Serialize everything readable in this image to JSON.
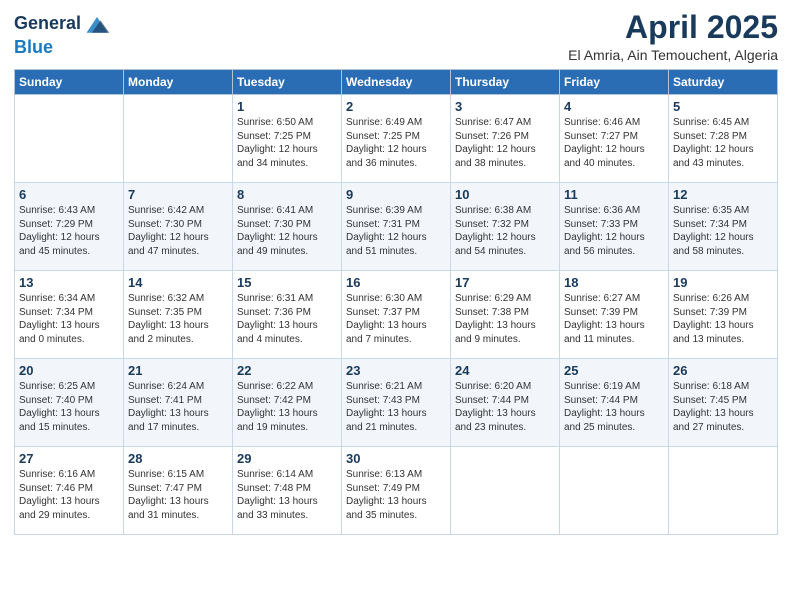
{
  "logo": {
    "line1": "General",
    "line2": "Blue"
  },
  "title": "April 2025",
  "subtitle": "El Amria, Ain Temouchent, Algeria",
  "weekdays": [
    "Sunday",
    "Monday",
    "Tuesday",
    "Wednesday",
    "Thursday",
    "Friday",
    "Saturday"
  ],
  "weeks": [
    [
      null,
      null,
      {
        "day": 1,
        "sunrise": "6:50 AM",
        "sunset": "7:25 PM",
        "daylight": "12 hours and 34 minutes."
      },
      {
        "day": 2,
        "sunrise": "6:49 AM",
        "sunset": "7:25 PM",
        "daylight": "12 hours and 36 minutes."
      },
      {
        "day": 3,
        "sunrise": "6:47 AM",
        "sunset": "7:26 PM",
        "daylight": "12 hours and 38 minutes."
      },
      {
        "day": 4,
        "sunrise": "6:46 AM",
        "sunset": "7:27 PM",
        "daylight": "12 hours and 40 minutes."
      },
      {
        "day": 5,
        "sunrise": "6:45 AM",
        "sunset": "7:28 PM",
        "daylight": "12 hours and 43 minutes."
      }
    ],
    [
      {
        "day": 6,
        "sunrise": "6:43 AM",
        "sunset": "7:29 PM",
        "daylight": "12 hours and 45 minutes."
      },
      {
        "day": 7,
        "sunrise": "6:42 AM",
        "sunset": "7:30 PM",
        "daylight": "12 hours and 47 minutes."
      },
      {
        "day": 8,
        "sunrise": "6:41 AM",
        "sunset": "7:30 PM",
        "daylight": "12 hours and 49 minutes."
      },
      {
        "day": 9,
        "sunrise": "6:39 AM",
        "sunset": "7:31 PM",
        "daylight": "12 hours and 51 minutes."
      },
      {
        "day": 10,
        "sunrise": "6:38 AM",
        "sunset": "7:32 PM",
        "daylight": "12 hours and 54 minutes."
      },
      {
        "day": 11,
        "sunrise": "6:36 AM",
        "sunset": "7:33 PM",
        "daylight": "12 hours and 56 minutes."
      },
      {
        "day": 12,
        "sunrise": "6:35 AM",
        "sunset": "7:34 PM",
        "daylight": "12 hours and 58 minutes."
      }
    ],
    [
      {
        "day": 13,
        "sunrise": "6:34 AM",
        "sunset": "7:34 PM",
        "daylight": "13 hours and 0 minutes."
      },
      {
        "day": 14,
        "sunrise": "6:32 AM",
        "sunset": "7:35 PM",
        "daylight": "13 hours and 2 minutes."
      },
      {
        "day": 15,
        "sunrise": "6:31 AM",
        "sunset": "7:36 PM",
        "daylight": "13 hours and 4 minutes."
      },
      {
        "day": 16,
        "sunrise": "6:30 AM",
        "sunset": "7:37 PM",
        "daylight": "13 hours and 7 minutes."
      },
      {
        "day": 17,
        "sunrise": "6:29 AM",
        "sunset": "7:38 PM",
        "daylight": "13 hours and 9 minutes."
      },
      {
        "day": 18,
        "sunrise": "6:27 AM",
        "sunset": "7:39 PM",
        "daylight": "13 hours and 11 minutes."
      },
      {
        "day": 19,
        "sunrise": "6:26 AM",
        "sunset": "7:39 PM",
        "daylight": "13 hours and 13 minutes."
      }
    ],
    [
      {
        "day": 20,
        "sunrise": "6:25 AM",
        "sunset": "7:40 PM",
        "daylight": "13 hours and 15 minutes."
      },
      {
        "day": 21,
        "sunrise": "6:24 AM",
        "sunset": "7:41 PM",
        "daylight": "13 hours and 17 minutes."
      },
      {
        "day": 22,
        "sunrise": "6:22 AM",
        "sunset": "7:42 PM",
        "daylight": "13 hours and 19 minutes."
      },
      {
        "day": 23,
        "sunrise": "6:21 AM",
        "sunset": "7:43 PM",
        "daylight": "13 hours and 21 minutes."
      },
      {
        "day": 24,
        "sunrise": "6:20 AM",
        "sunset": "7:44 PM",
        "daylight": "13 hours and 23 minutes."
      },
      {
        "day": 25,
        "sunrise": "6:19 AM",
        "sunset": "7:44 PM",
        "daylight": "13 hours and 25 minutes."
      },
      {
        "day": 26,
        "sunrise": "6:18 AM",
        "sunset": "7:45 PM",
        "daylight": "13 hours and 27 minutes."
      }
    ],
    [
      {
        "day": 27,
        "sunrise": "6:16 AM",
        "sunset": "7:46 PM",
        "daylight": "13 hours and 29 minutes."
      },
      {
        "day": 28,
        "sunrise": "6:15 AM",
        "sunset": "7:47 PM",
        "daylight": "13 hours and 31 minutes."
      },
      {
        "day": 29,
        "sunrise": "6:14 AM",
        "sunset": "7:48 PM",
        "daylight": "13 hours and 33 minutes."
      },
      {
        "day": 30,
        "sunrise": "6:13 AM",
        "sunset": "7:49 PM",
        "daylight": "13 hours and 35 minutes."
      },
      null,
      null,
      null
    ]
  ]
}
